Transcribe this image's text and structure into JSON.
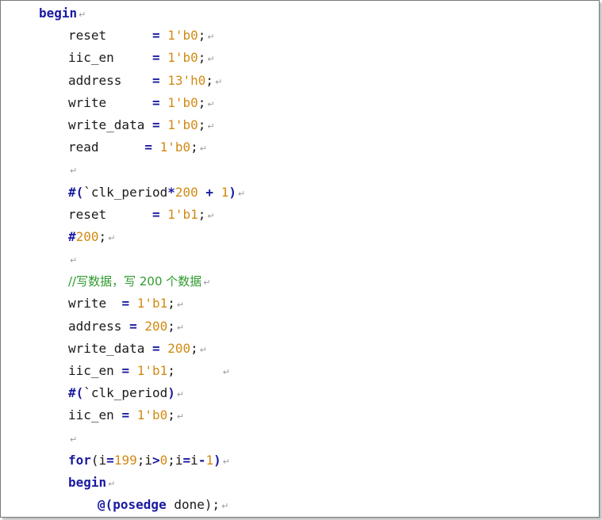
{
  "lines": [
    {
      "indent": 48,
      "tokens": [
        {
          "t": "begin",
          "c": "kw"
        }
      ]
    },
    {
      "indent": 85,
      "tokens": [
        {
          "t": "reset      ",
          "c": "plain"
        },
        {
          "t": "=",
          "c": "kw"
        },
        {
          "t": " ",
          "c": "plain"
        },
        {
          "t": "1'b0",
          "c": "num"
        },
        {
          "t": ";",
          "c": "plain"
        }
      ]
    },
    {
      "indent": 85,
      "tokens": [
        {
          "t": "iic_en     ",
          "c": "plain"
        },
        {
          "t": "=",
          "c": "kw"
        },
        {
          "t": " ",
          "c": "plain"
        },
        {
          "t": "1'b0",
          "c": "num"
        },
        {
          "t": ";",
          "c": "plain"
        }
      ]
    },
    {
      "indent": 85,
      "tokens": [
        {
          "t": "address    ",
          "c": "plain"
        },
        {
          "t": "=",
          "c": "kw"
        },
        {
          "t": " ",
          "c": "plain"
        },
        {
          "t": "13'h0",
          "c": "num"
        },
        {
          "t": ";",
          "c": "plain"
        }
      ]
    },
    {
      "indent": 85,
      "tokens": [
        {
          "t": "write      ",
          "c": "plain"
        },
        {
          "t": "=",
          "c": "kw"
        },
        {
          "t": " ",
          "c": "plain"
        },
        {
          "t": "1'b0",
          "c": "num"
        },
        {
          "t": ";",
          "c": "plain"
        }
      ]
    },
    {
      "indent": 85,
      "tokens": [
        {
          "t": "write_data ",
          "c": "plain"
        },
        {
          "t": "=",
          "c": "kw"
        },
        {
          "t": " ",
          "c": "plain"
        },
        {
          "t": "1'b0",
          "c": "num"
        },
        {
          "t": ";",
          "c": "plain"
        }
      ]
    },
    {
      "indent": 85,
      "tokens": [
        {
          "t": "read      ",
          "c": "plain"
        },
        {
          "t": "=",
          "c": "kw"
        },
        {
          "t": " ",
          "c": "plain"
        },
        {
          "t": "1'b0",
          "c": "num"
        },
        {
          "t": ";",
          "c": "plain"
        }
      ]
    },
    {
      "indent": 85,
      "tokens": []
    },
    {
      "indent": 85,
      "tokens": [
        {
          "t": "#(",
          "c": "kw"
        },
        {
          "t": "`clk_period",
          "c": "plain"
        },
        {
          "t": "*",
          "c": "kw"
        },
        {
          "t": "200",
          "c": "num"
        },
        {
          "t": " ",
          "c": "plain"
        },
        {
          "t": "+",
          "c": "kw"
        },
        {
          "t": " ",
          "c": "plain"
        },
        {
          "t": "1",
          "c": "num"
        },
        {
          "t": ")",
          "c": "kw"
        }
      ]
    },
    {
      "indent": 85,
      "tokens": [
        {
          "t": "reset      ",
          "c": "plain"
        },
        {
          "t": "=",
          "c": "kw"
        },
        {
          "t": " ",
          "c": "plain"
        },
        {
          "t": "1'b1",
          "c": "num"
        },
        {
          "t": ";",
          "c": "plain"
        }
      ]
    },
    {
      "indent": 85,
      "tokens": [
        {
          "t": "#",
          "c": "kw"
        },
        {
          "t": "200",
          "c": "num"
        },
        {
          "t": ";",
          "c": "plain"
        }
      ]
    },
    {
      "indent": 85,
      "tokens": []
    },
    {
      "indent": 85,
      "tokens": [
        {
          "t": "//写数据，写 200 个数据",
          "c": "cm"
        }
      ]
    },
    {
      "indent": 85,
      "tokens": [
        {
          "t": "write  ",
          "c": "plain"
        },
        {
          "t": "=",
          "c": "kw"
        },
        {
          "t": " ",
          "c": "plain"
        },
        {
          "t": "1'b1",
          "c": "num"
        },
        {
          "t": ";",
          "c": "plain"
        }
      ]
    },
    {
      "indent": 85,
      "tokens": [
        {
          "t": "address ",
          "c": "plain"
        },
        {
          "t": "=",
          "c": "kw"
        },
        {
          "t": " ",
          "c": "plain"
        },
        {
          "t": "200",
          "c": "num"
        },
        {
          "t": ";",
          "c": "plain"
        }
      ]
    },
    {
      "indent": 85,
      "tokens": [
        {
          "t": "write_data ",
          "c": "plain"
        },
        {
          "t": "=",
          "c": "kw"
        },
        {
          "t": " ",
          "c": "plain"
        },
        {
          "t": "200",
          "c": "num"
        },
        {
          "t": ";",
          "c": "plain"
        }
      ]
    },
    {
      "indent": 85,
      "tokens": [
        {
          "t": "iic_en ",
          "c": "plain"
        },
        {
          "t": "=",
          "c": "kw"
        },
        {
          "t": " ",
          "c": "plain"
        },
        {
          "t": "1'b1",
          "c": "num"
        },
        {
          "t": ";      ",
          "c": "plain"
        }
      ]
    },
    {
      "indent": 85,
      "tokens": [
        {
          "t": "#(",
          "c": "kw"
        },
        {
          "t": "`clk_period",
          "c": "plain"
        },
        {
          "t": ")",
          "c": "kw"
        }
      ]
    },
    {
      "indent": 85,
      "tokens": [
        {
          "t": "iic_en ",
          "c": "plain"
        },
        {
          "t": "=",
          "c": "kw"
        },
        {
          "t": " ",
          "c": "plain"
        },
        {
          "t": "1'b0",
          "c": "num"
        },
        {
          "t": ";",
          "c": "plain"
        }
      ]
    },
    {
      "indent": 85,
      "tokens": []
    },
    {
      "indent": 85,
      "tokens": [
        {
          "t": "for",
          "c": "kw"
        },
        {
          "t": "(i",
          "c": "plain"
        },
        {
          "t": "=",
          "c": "kw"
        },
        {
          "t": "199",
          "c": "num"
        },
        {
          "t": ";i",
          "c": "plain"
        },
        {
          "t": ">",
          "c": "kw"
        },
        {
          "t": "0",
          "c": "num"
        },
        {
          "t": ";i",
          "c": "plain"
        },
        {
          "t": "=",
          "c": "kw"
        },
        {
          "t": "i",
          "c": "plain"
        },
        {
          "t": "-",
          "c": "kw"
        },
        {
          "t": "1",
          "c": "num"
        },
        {
          "t": ")",
          "c": "kw"
        }
      ]
    },
    {
      "indent": 85,
      "tokens": [
        {
          "t": "begin",
          "c": "kw"
        }
      ]
    },
    {
      "indent": 122,
      "tokens": [
        {
          "t": "@(",
          "c": "kw"
        },
        {
          "t": "posedge",
          "c": "kw"
        },
        {
          "t": " done);",
          "c": "plain"
        }
      ]
    }
  ],
  "paragraph_mark": "↵"
}
